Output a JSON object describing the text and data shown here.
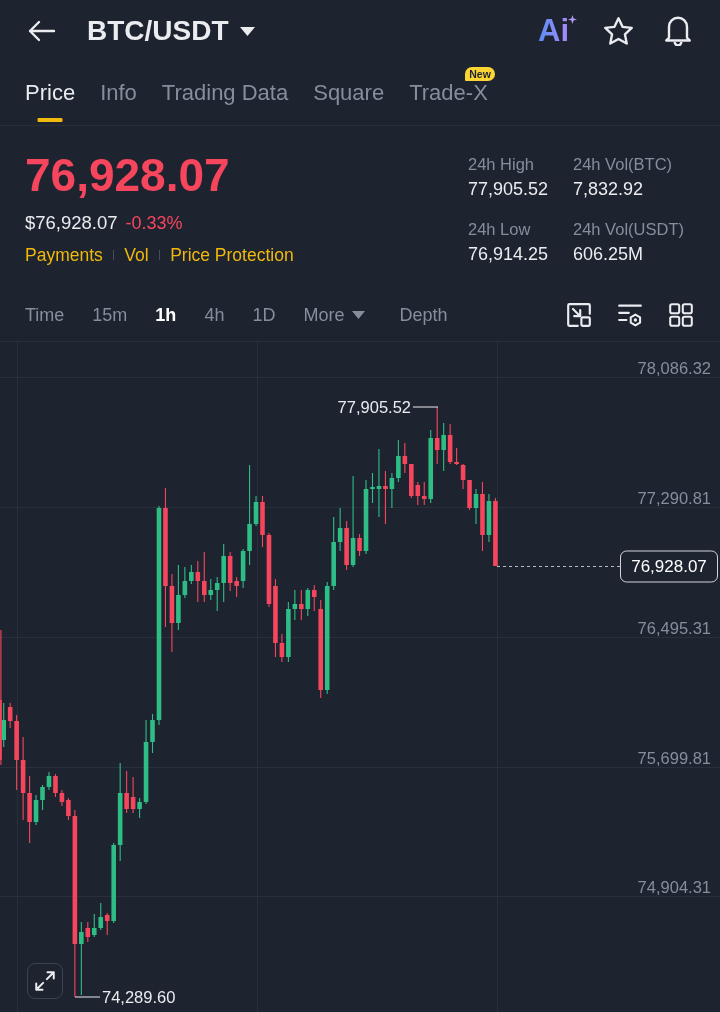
{
  "header": {
    "title": "BTC/USDT",
    "ai_label": "Ai"
  },
  "tabs": [
    {
      "label": "Price",
      "selected": true
    },
    {
      "label": "Info",
      "selected": false
    },
    {
      "label": "Trading Data",
      "selected": false
    },
    {
      "label": "Square",
      "selected": false
    },
    {
      "label": "Trade-X",
      "selected": false,
      "badge": "New"
    }
  ],
  "price": {
    "last": "76,928.07",
    "falling": true,
    "usd_value": "$76,928.07",
    "change": "-0.33%",
    "links": [
      "Payments",
      "Vol",
      "Price Protection"
    ]
  },
  "stats": [
    {
      "label": "24h High",
      "value": "77,905.52"
    },
    {
      "label": "24h Vol(BTC)",
      "value": "7,832.92"
    },
    {
      "label": "24h Low",
      "value": "76,914.25"
    },
    {
      "label": "24h Vol(USDT)",
      "value": "606.25M"
    }
  ],
  "intervals": [
    {
      "label": "Time",
      "kind": "option",
      "selected": false
    },
    {
      "label": "15m",
      "kind": "option",
      "selected": false
    },
    {
      "label": "1h",
      "kind": "option",
      "selected": true
    },
    {
      "label": "4h",
      "kind": "option",
      "selected": false
    },
    {
      "label": "1D",
      "kind": "option",
      "selected": false
    },
    {
      "label": "More",
      "kind": "dropdown",
      "selected": false
    },
    {
      "label": "Depth",
      "kind": "option",
      "selected": false
    }
  ],
  "chart": {
    "price_axis": [
      "78,086.32",
      "77,290.81",
      "76,495.31",
      "75,699.81",
      "74,904.31"
    ],
    "high_label": "77,905.52",
    "low_label": "74,289.60",
    "last_price": "76,928.07"
  }
}
